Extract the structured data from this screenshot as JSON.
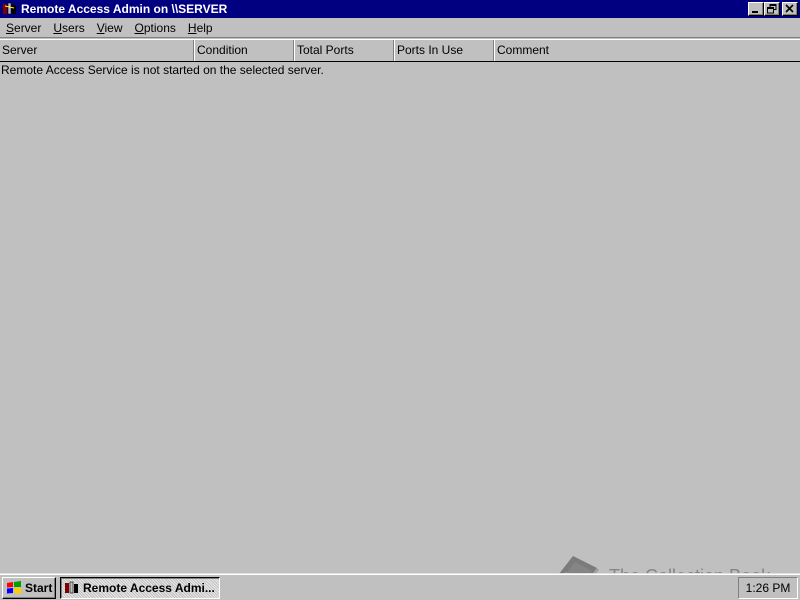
{
  "window": {
    "title": "Remote Access Admin on \\\\SERVER",
    "title_icon": "remote-access-icon",
    "buttons": [
      "minimize-icon",
      "restore-icon",
      "close-icon"
    ]
  },
  "menu": {
    "items": [
      {
        "label": "Server",
        "accel": "S"
      },
      {
        "label": "Users",
        "accel": "U"
      },
      {
        "label": "View",
        "accel": "V"
      },
      {
        "label": "Options",
        "accel": "O"
      },
      {
        "label": "Help",
        "accel": "H"
      }
    ]
  },
  "columns": [
    "Server",
    "Condition",
    "Total Ports",
    "Ports In Use",
    "Comment"
  ],
  "status_message": "Remote Access Service is not started on the selected server.",
  "watermark": {
    "text": "The Collection Book",
    "icon": "book-icon"
  },
  "taskbar": {
    "start_label": "Start",
    "start_icon": "windows-logo-icon",
    "task_label": "Remote Access Admi...",
    "task_icon": "remote-access-icon",
    "clock": "1:26 PM"
  },
  "colors": {
    "titlebar": "#000080",
    "face": "#c0c0c0"
  }
}
